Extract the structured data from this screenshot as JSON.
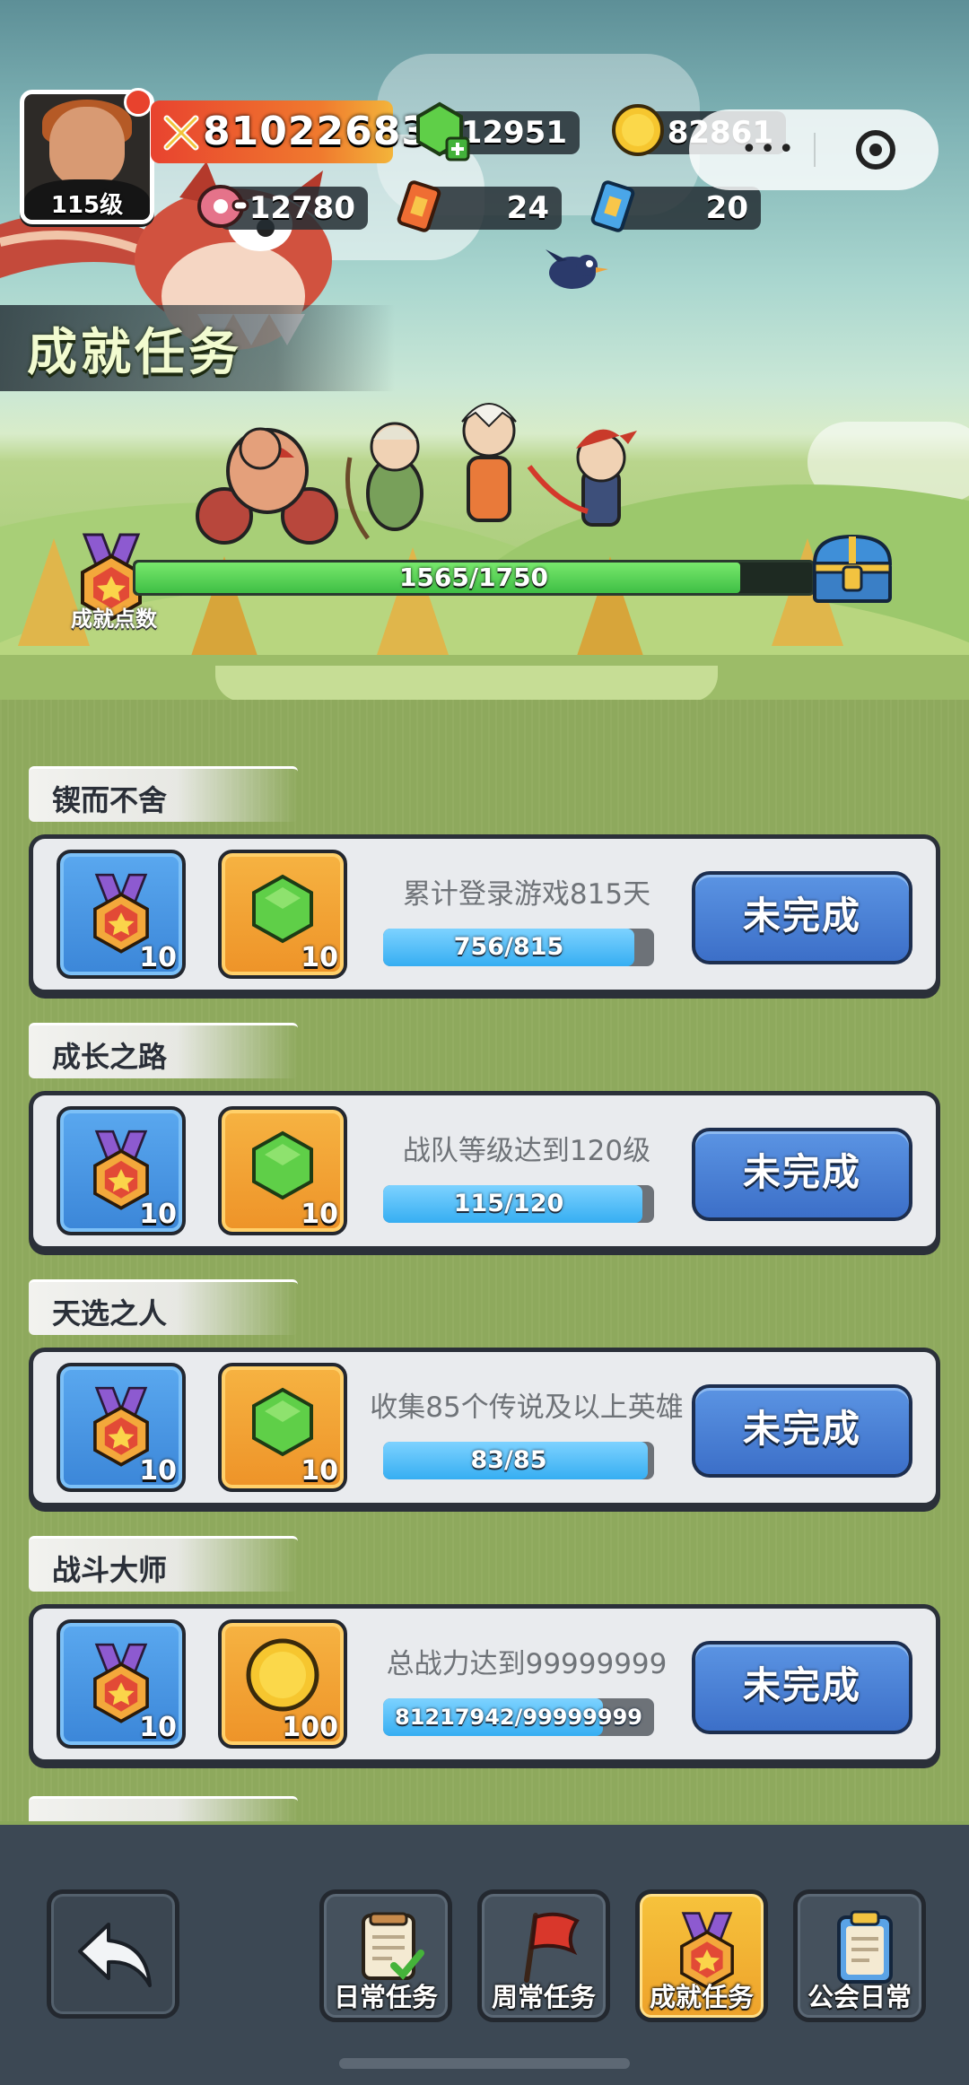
{
  "hud": {
    "level": "115级",
    "power": "81022683",
    "gems": "12951",
    "gold": "82861",
    "meat": "12780",
    "ticket_red": "24",
    "ticket_blue": "20"
  },
  "page": {
    "title": "成就任务"
  },
  "achievement": {
    "label": "成就点数",
    "progress_text": "1565/1750",
    "current": 1565,
    "max": 1750
  },
  "categories": [
    {
      "name": "锲而不舍",
      "task": {
        "desc": "累计登录游戏815天",
        "progress": "756/815",
        "fraction": 0.928,
        "reward1_icon": "medal-icon",
        "reward1_count": "10",
        "reward2_icon": "gem-icon",
        "reward2_count": "10",
        "button": "未完成"
      }
    },
    {
      "name": "成长之路",
      "task": {
        "desc": "战队等级达到120级",
        "progress": "115/120",
        "fraction": 0.958,
        "reward1_icon": "medal-icon",
        "reward1_count": "10",
        "reward2_icon": "gem-icon",
        "reward2_count": "10",
        "button": "未完成"
      }
    },
    {
      "name": "天选之人",
      "task": {
        "desc": "收集85个传说及以上英雄",
        "progress": "83/85",
        "fraction": 0.976,
        "reward1_icon": "medal-icon",
        "reward1_count": "10",
        "reward2_icon": "gem-icon",
        "reward2_count": "10",
        "button": "未完成"
      }
    },
    {
      "name": "战斗大师",
      "task": {
        "desc": "总战力达到99999999",
        "progress": "81217942/99999999",
        "fraction": 0.812,
        "reward1_icon": "medal-icon",
        "reward1_count": "10",
        "reward2_icon": "gold-coin-icon",
        "reward2_count": "100",
        "button": "未完成"
      }
    }
  ],
  "nav": [
    {
      "label": "日常任务",
      "icon": "daily-task-icon"
    },
    {
      "label": "周常任务",
      "icon": "weekly-flag-icon"
    },
    {
      "label": "成就任务",
      "icon": "achievement-medal-icon",
      "active": true
    },
    {
      "label": "公会日常",
      "icon": "guild-clipboard-icon"
    }
  ],
  "colors": {
    "accent_blue": "#3c6fc8",
    "progress_green": "#3fbf45",
    "active_tab": "#f6c33c"
  }
}
